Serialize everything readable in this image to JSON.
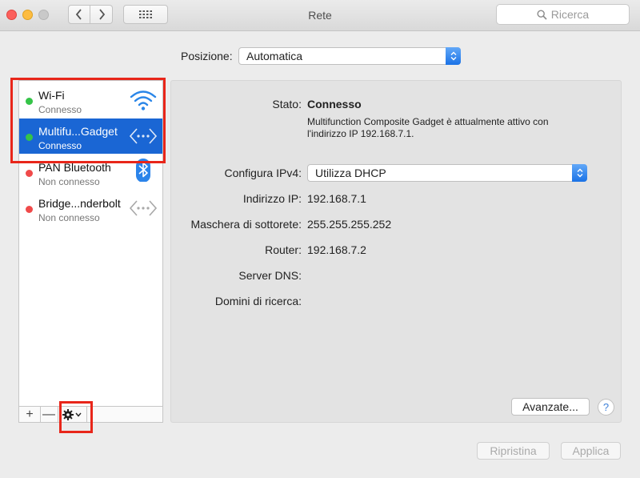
{
  "window": {
    "title": "Rete"
  },
  "toolbar": {
    "search_placeholder": "Ricerca"
  },
  "location": {
    "label": "Posizione:",
    "value": "Automatica"
  },
  "services": [
    {
      "name": "Wi-Fi",
      "status": "Connesso",
      "status_color": "#35c448",
      "icon": "wifi-icon",
      "selected": false
    },
    {
      "name": "Multifu...Gadget",
      "status": "Connesso",
      "status_color": "#35c448",
      "icon": "ethernet-arrows-icon",
      "selected": true
    },
    {
      "name": "PAN Bluetooth",
      "status": "Non connesso",
      "status_color": "#f04a4a",
      "icon": "bluetooth-icon",
      "selected": false
    },
    {
      "name": "Bridge...nderbolt",
      "status": "Non connesso",
      "status_color": "#f04a4a",
      "icon": "ethernet-arrows-icon",
      "selected": false
    }
  ],
  "sidebar_actions": {
    "add": "+",
    "remove": "—"
  },
  "detail": {
    "status_label": "Stato:",
    "status_value": "Connesso",
    "description": "Multifunction Composite Gadget è attualmente attivo con l'indirizzo IP 192.168.7.1.",
    "configure_ipv4_label": "Configura IPv4:",
    "configure_ipv4_value": "Utilizza DHCP",
    "ip_label": "Indirizzo IP:",
    "ip_value": "192.168.7.1",
    "subnet_label": "Maschera di sottorete:",
    "subnet_value": "255.255.255.252",
    "router_label": "Router:",
    "router_value": "192.168.7.2",
    "dns_label": "Server DNS:",
    "dns_value": "",
    "search_domains_label": "Domini di ricerca:",
    "search_domains_value": ""
  },
  "buttons": {
    "advanced": "Avanzate...",
    "help": "?",
    "revert": "Ripristina",
    "apply": "Applica"
  },
  "colors": {
    "accent": "#1a66d4",
    "highlight": "#e8261a"
  }
}
